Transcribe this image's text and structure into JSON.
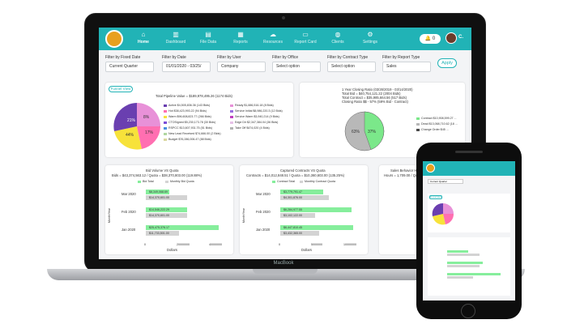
{
  "app": {
    "device_label": "MacBook",
    "colors": {
      "primary": "#21b3b6",
      "bg": "#f3f4f6"
    }
  },
  "nav": {
    "items": [
      {
        "label": "Home",
        "icon": "home-icon",
        "active": true
      },
      {
        "label": "Dashboard",
        "icon": "bar-chart-icon",
        "active": false
      },
      {
        "label": "File Data",
        "icon": "file-icon",
        "active": false
      },
      {
        "label": "Reports",
        "icon": "report-icon",
        "active": false
      },
      {
        "label": "Resources",
        "icon": "cloud-icon",
        "active": false
      },
      {
        "label": "Report Card",
        "icon": "card-icon",
        "active": false
      },
      {
        "label": "Clients",
        "icon": "globe-icon",
        "active": false
      },
      {
        "label": "Settings",
        "icon": "gear-icon",
        "active": false
      }
    ],
    "notification_count": "0",
    "user_initials": "C."
  },
  "filters": [
    {
      "label": "Filter by Fixed Date",
      "value": "Current Quarter"
    },
    {
      "label": "Filter by Date",
      "value": "01/01/2020 - 03/25/"
    },
    {
      "label": "Filter by User",
      "value": "Company"
    },
    {
      "label": "Filter by Office",
      "value": "Select option"
    },
    {
      "label": "Filter by Contract Type",
      "value": "Select option"
    },
    {
      "label": "Filter by Report Type",
      "value": "Sales"
    }
  ],
  "apply_label": "Apply",
  "funnel_view_label": "Funnel View",
  "pipeline": {
    "title": "Total Pipeline Value = $189,978,495.26 (1174 Bids)",
    "legend": [
      {
        "label": "Active $4,505,836.36 (143 Bids)",
        "color": "#6a3fb0"
      },
      {
        "label": "Hot $38,423,993.22 (94 Bids)",
        "color": "#ff6fb1"
      },
      {
        "label": "Warm $96,608,823.77 (266 Bids)",
        "color": "#f7e23a"
      },
      {
        "label": "CTOSigned $5,230,173.78 (30 Bids)",
        "color": "#7c4dd8"
      },
      {
        "label": "RSPCC $13,607,931.75 (51 Bids)",
        "color": "#4a8fe0"
      },
      {
        "label": "New Lead Received $74,666.00 (2 Bids)",
        "color": "#b0d6a0"
      },
      {
        "label": "Budget $76,286,006.47 (88 Bids)",
        "color": "#d9d7a0"
      },
      {
        "label": "Ready $1,886,516.18 (8 Bids)",
        "color": "#e891d8"
      },
      {
        "label": "Service Initial $8,986,220.3 (12 Bids)",
        "color": "#9a6fe0"
      },
      {
        "label": "Service Warm $3,940,214 (9 Bids)",
        "color": "#c03fbf"
      },
      {
        "label": "Edge Dir $2,347,384.04 (36 Bids)",
        "color": "#e7c0e8"
      },
      {
        "label": "Take Off $474,020 (4 Bids)",
        "color": "#b3b3b3"
      }
    ]
  },
  "closing": {
    "title_lines": [
      "1 Year Closing Ratio (03/26/2019 - 03/14/2020)",
      "Total Bid = $40,754,121.22 (2004 Bids)",
      "Total Contract = $35,985,664.56 (517 Bids)",
      "Closing Ratio $$ - 57% (59% Bid - Contract)"
    ],
    "legend": [
      {
        "label": "Contract $10,908,599.27 ...",
        "color": "#7be88a"
      },
      {
        "label": "Dead $13,068,710.62 (18 ...",
        "color": "#b8b8b8"
      },
      {
        "label": "Change Order $45 ...",
        "color": "#4a4a4a"
      }
    ]
  },
  "bars": [
    {
      "title": "Bid Volume VS Quota",
      "subtitle": "Bids = $43,374,563.12 / Quota = $38,370,803.00 (119.88%)",
      "legend": [
        "Bid Total",
        "Monthly Bid Quota"
      ],
      "xlabel": "Dollars",
      "ylabel": "Month/Year",
      "rows": [
        {
          "month": "Mar 2020",
          "a_label": "$8,349,068.69",
          "b_label": "$14,370,601.00",
          "a": 8349068.69,
          "b": 14370601
        },
        {
          "month": "Feb 2020",
          "a_label": "$14,546,222.29",
          "b_label": "$14,370,601.00",
          "a": 14546222.29,
          "b": 14370601
        },
        {
          "month": "Jan 2020",
          "a_label": "$25,475,376.17",
          "b_label": "$11,733,501.00",
          "a": 25475376.17,
          "b": 11733501
        }
      ],
      "xticks": [
        "0",
        "20000000",
        "40000000"
      ],
      "a_color": "#86ee9c",
      "b_color": "#d3d3d3"
    },
    {
      "title": "Captured Contracts VS Quota",
      "subtitle": "Contracts = $14,012,848.51 / Quota = $10,360,603.00 (135.25%)",
      "legend": [
        "Contract Total",
        "Monthly Contract Quota"
      ],
      "xlabel": "Dollars",
      "ylabel": "Month/Year",
      "rows": [
        {
          "month": "Mar 2020",
          "a_label": "$3,779,791.47",
          "b_label": "$4,301,876.00",
          "a": 3779791.47,
          "b": 4301876
        },
        {
          "month": "Feb 2020",
          "a_label": "$6,284,977.55",
          "b_label": "$3,102,122.00",
          "a": 6284977.55,
          "b": 3102122
        },
        {
          "month": "Jan 2020",
          "a_label": "$6,447,810.45",
          "b_label": "$3,432,365.00",
          "a": 6447810.45,
          "b": 3432365
        }
      ],
      "xticks": [
        "0",
        "5000000",
        "10000000"
      ],
      "a_color": "#86ee9c",
      "b_color": "#d3d3d3"
    }
  ],
  "partial_card": {
    "title": "Sales Behavior Hours V...",
    "line": "Hours = 1,709.00 / Quota ..."
  },
  "phone": {
    "filter_value": "Current Quarter",
    "funnel_label": "Funnel View"
  }
}
